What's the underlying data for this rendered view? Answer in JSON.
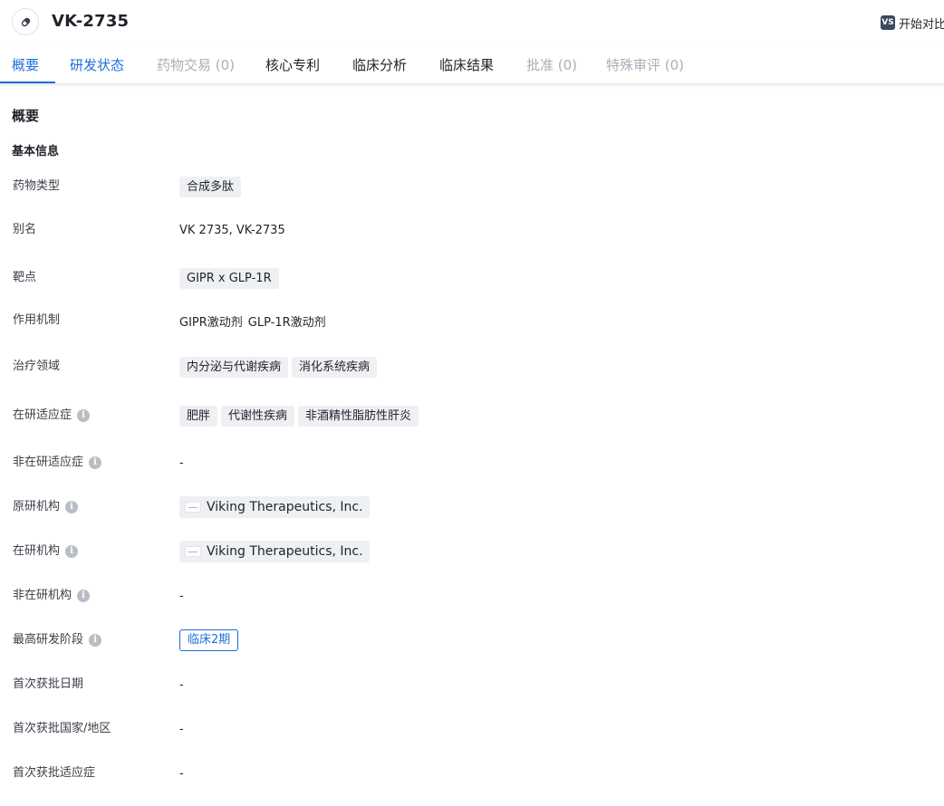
{
  "header": {
    "title": "VK-2735",
    "compare_badge": "VS",
    "compare_label": "开始对比"
  },
  "tabs": [
    {
      "label": "概要",
      "state": "active"
    },
    {
      "label": "研发状态",
      "state": "link"
    },
    {
      "label": "药物交易 (0)",
      "state": "disabled"
    },
    {
      "label": "核心专利",
      "state": "normal"
    },
    {
      "label": "临床分析",
      "state": "normal"
    },
    {
      "label": "临床结果",
      "state": "normal"
    },
    {
      "label": "批准 (0)",
      "state": "disabled"
    },
    {
      "label": "特殊审评 (0)",
      "state": "disabled"
    }
  ],
  "section": {
    "title": "概要",
    "subtitle": "基本信息"
  },
  "fields": {
    "drug_type": {
      "label": "药物类型",
      "tags": [
        "合成多肽"
      ]
    },
    "alias": {
      "label": "别名",
      "value": "VK 2735,  VK-2735"
    },
    "target": {
      "label": "靶点",
      "tags": [
        "GIPR x GLP-1R"
      ]
    },
    "mechanism": {
      "label": "作用机制",
      "items": [
        "GIPR激动剂",
        "GLP-1R激动剂"
      ]
    },
    "therapeutic_area": {
      "label": "治疗领域",
      "tags": [
        "内分泌与代谢疾病",
        "消化系统疾病"
      ]
    },
    "active_indication": {
      "label": "在研适应症",
      "tags": [
        "肥胖",
        "代谢性疾病",
        "非酒精性脂肪性肝炎"
      ]
    },
    "inactive_indication": {
      "label": "非在研适应症",
      "value": "-"
    },
    "originator": {
      "label": "原研机构",
      "org": "Viking Therapeutics, Inc."
    },
    "active_org": {
      "label": "在研机构",
      "org": "Viking Therapeutics, Inc."
    },
    "inactive_org": {
      "label": "非在研机构",
      "value": "-"
    },
    "highest_phase": {
      "label": "最高研发阶段",
      "phase": "临床2期"
    },
    "first_approval_date": {
      "label": "首次获批日期",
      "value": "-"
    },
    "first_approval_country": {
      "label": "首次获批国家/地区",
      "value": "-"
    },
    "first_approval_indication": {
      "label": "首次获批适应症",
      "value": "-"
    }
  },
  "info_icon_glyph": "i",
  "colors": {
    "accent": "#1e6fd9",
    "disabled": "#a9aeb8",
    "tag_bg": "#eef0f3"
  }
}
